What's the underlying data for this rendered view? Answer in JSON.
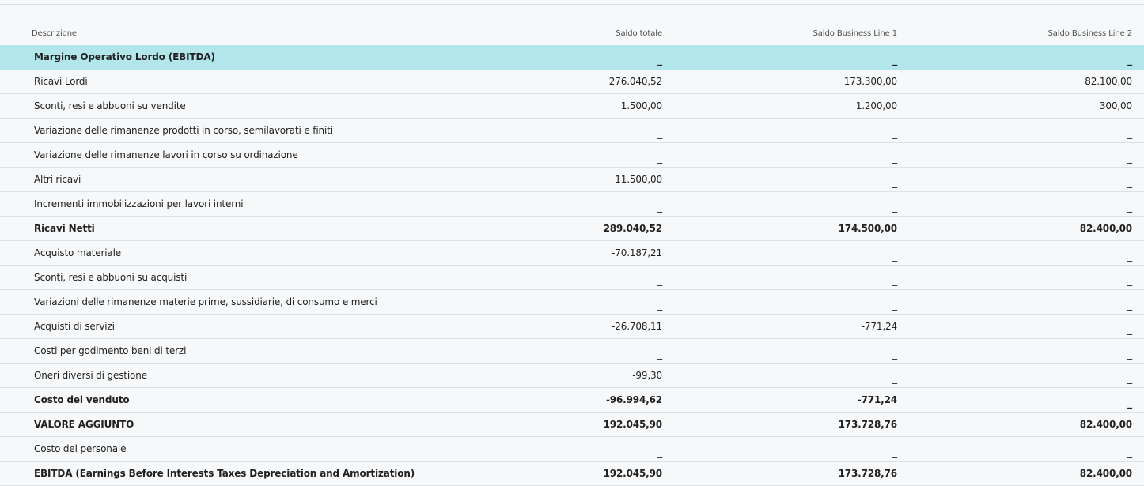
{
  "columns": {
    "desc": "Descrizione",
    "total": "Saldo totale",
    "bl1": "Saldo Business Line 1",
    "bl2": "Saldo Business Line 2"
  },
  "rows": [
    {
      "label": "Margine Operativo Lordo (EBITDA)",
      "total": "_",
      "bl1": "_",
      "bl2": "_"
    },
    {
      "label": "Ricavi Lordi",
      "total": "276.040,52",
      "bl1": "173.300,00",
      "bl2": "82.100,00"
    },
    {
      "label": "Sconti, resi e abbuoni su vendite",
      "total": "1.500,00",
      "bl1": "1.200,00",
      "bl2": "300,00"
    },
    {
      "label": "Variazione delle rimanenze prodotti in corso, semilavorati e finiti",
      "total": "_",
      "bl1": "_",
      "bl2": "_"
    },
    {
      "label": "Variazione delle rimanenze lavori in corso su ordinazione",
      "total": "_",
      "bl1": "_",
      "bl2": "_"
    },
    {
      "label": "Altri ricavi",
      "total": "11.500,00",
      "bl1": "_",
      "bl2": "_"
    },
    {
      "label": "Incrementi immobilizzazioni per lavori interni",
      "total": "_",
      "bl1": "_",
      "bl2": "_"
    },
    {
      "label": "Ricavi Netti",
      "total": "289.040,52",
      "bl1": "174.500,00",
      "bl2": "82.400,00"
    },
    {
      "label": "Acquisto materiale",
      "total": "-70.187,21",
      "bl1": "_",
      "bl2": "_"
    },
    {
      "label": "Sconti, resi e abbuoni su acquisti",
      "total": "_",
      "bl1": "_",
      "bl2": "_"
    },
    {
      "label": "Variazioni delle rimanenze materie prime, sussidiarie, di consumo e merci",
      "total": "_",
      "bl1": "_",
      "bl2": "_"
    },
    {
      "label": "Acquisti di servizi",
      "total": "-26.708,11",
      "bl1": "-771,24",
      "bl2": "_"
    },
    {
      "label": "Costi per godimento beni di terzi",
      "total": "_",
      "bl1": "_",
      "bl2": "_"
    },
    {
      "label": "Oneri diversi di gestione",
      "total": "-99,30",
      "bl1": "_",
      "bl2": "_"
    },
    {
      "label": "Costo del venduto",
      "total": "-96.994,62",
      "bl1": "-771,24",
      "bl2": "_"
    },
    {
      "label": "VALORE AGGIUNTO",
      "total": "192.045,90",
      "bl1": "173.728,76",
      "bl2": "82.400,00"
    },
    {
      "label": "Costo del personale",
      "total": "_",
      "bl1": "_",
      "bl2": "_"
    },
    {
      "label": "EBITDA (Earnings Before Interests Taxes Depreciation and Amortization)",
      "total": "192.045,90",
      "bl1": "173.728,76",
      "bl2": "82.400,00"
    }
  ]
}
